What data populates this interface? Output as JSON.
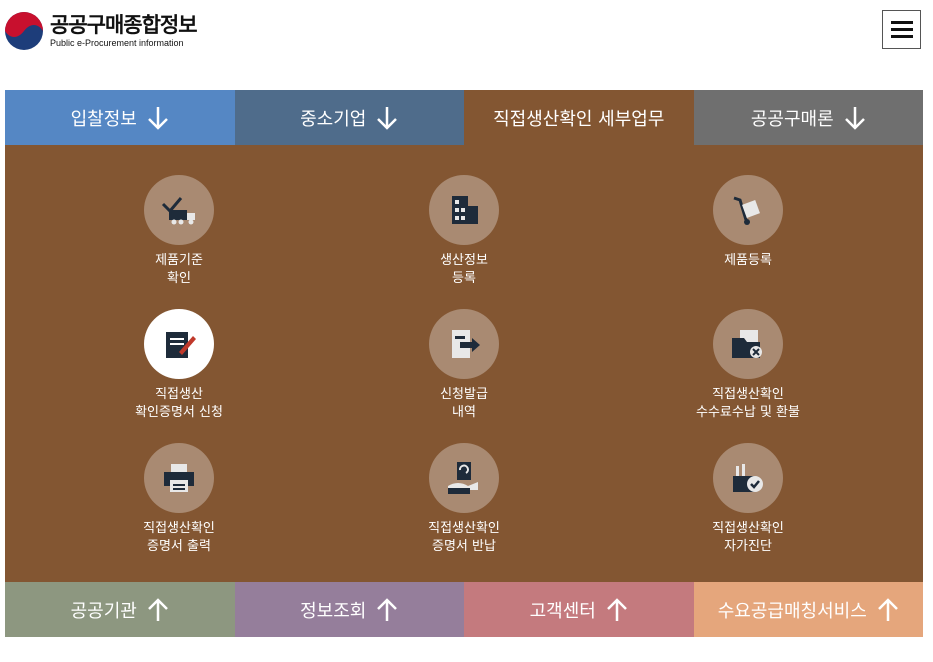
{
  "header": {
    "logo_title": "공공구매종합정보",
    "logo_subtitle": "Public e-Procurement information"
  },
  "tabs": [
    {
      "label": "입찰정보",
      "icon": "arrow-down-icon"
    },
    {
      "label": "중소기업",
      "icon": "arrow-down-icon"
    },
    {
      "label": "직접생산확인 세부업무"
    },
    {
      "label": "공공구매론",
      "icon": "arrow-down-icon"
    }
  ],
  "items": [
    {
      "line1": "제품기준",
      "line2": "확인",
      "icon": "truck-check-icon"
    },
    {
      "line1": "생산정보",
      "line2": "등록",
      "icon": "factory-icon"
    },
    {
      "line1": "제품등록",
      "line2": "",
      "icon": "hand-truck-icon"
    },
    {
      "line1": "직접생산",
      "line2": "확인증명서 신청",
      "icon": "notepad-pen-icon"
    },
    {
      "line1": "신청발급",
      "line2": "내역",
      "icon": "document-arrow-icon"
    },
    {
      "line1": "직접생산확인",
      "line2": "수수료수납 및 환불",
      "icon": "folder-cancel-icon"
    },
    {
      "line1": "직접생산확인",
      "line2": "증명서 출력",
      "icon": "printer-icon"
    },
    {
      "line1": "직접생산확인",
      "line2": "증명서 반납",
      "icon": "return-document-icon"
    },
    {
      "line1": "직접생산확인",
      "line2": "자가진단",
      "icon": "factory-check-icon"
    }
  ],
  "bottom_tabs": [
    {
      "label": "공공기관",
      "icon": "arrow-up-icon"
    },
    {
      "label": "정보조회",
      "icon": "arrow-up-icon"
    },
    {
      "label": "고객센터",
      "icon": "arrow-up-icon"
    },
    {
      "label": "수요공급매칭서비스",
      "icon": "arrow-up-icon"
    }
  ],
  "colors": {
    "tab_blue": "#5587c4",
    "tab_slate": "#4f6c8b",
    "panel_brown": "#835632",
    "tab_gray": "#6f6f6f",
    "bottom_olive": "#8d9780",
    "bottom_purple": "#957e9b",
    "bottom_rose": "#c47a7e",
    "bottom_orange": "#e5a67c"
  }
}
